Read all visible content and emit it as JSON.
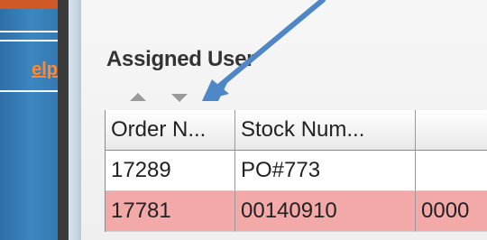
{
  "sidebar": {
    "help_link": "elp"
  },
  "section": {
    "title": "Assigned User"
  },
  "table": {
    "headers": [
      "Order N...",
      "Stock Num...",
      ""
    ],
    "rows": [
      {
        "highlighted": false,
        "cells": [
          "17289",
          "PO#773",
          ""
        ]
      },
      {
        "highlighted": true,
        "cells": [
          "17781",
          "00140910",
          "0000"
        ]
      }
    ]
  },
  "colors": {
    "sidebar_blue": "#3d86c1",
    "highlight_row": "#f4a9a9",
    "callout_arrow": "#4f86c6"
  },
  "icons": [
    "sort-up-icon",
    "sort-down-icon",
    "callout-arrow-icon"
  ]
}
